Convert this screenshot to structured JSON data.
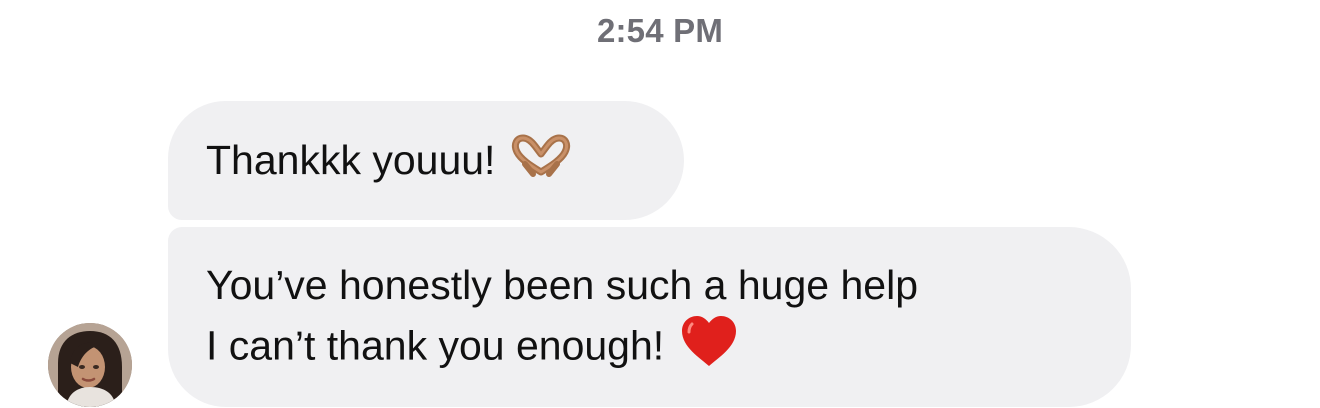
{
  "conversation": {
    "timestamp": "2:54 PM",
    "messages": [
      {
        "lines": [
          "Thankkk youuu!"
        ],
        "emoji": "heart-hands-icon"
      },
      {
        "lines": [
          "You’ve honestly been such a huge help",
          "I can’t thank you enough!"
        ],
        "emoji": "red-heart-icon"
      }
    ],
    "bubble_color": "#f0f0f2",
    "timestamp_color": "#6f6f76",
    "heart_color": "#e0201c"
  }
}
